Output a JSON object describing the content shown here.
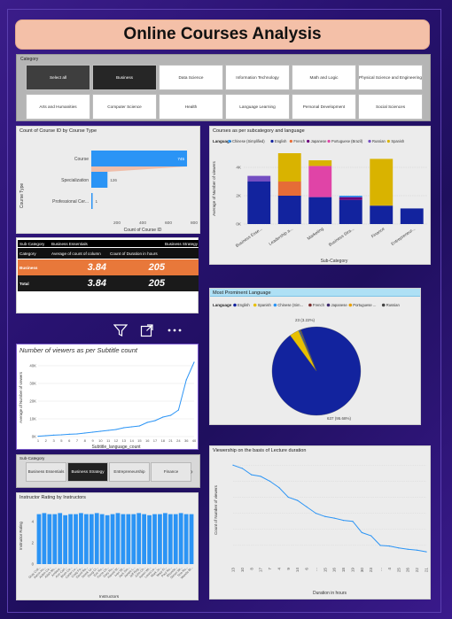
{
  "title": "Online Courses Analysis",
  "category_slicer": {
    "header": "Category",
    "row1": [
      "Select all",
      "Business",
      "Data Science",
      "Information Technology",
      "Math and Logic",
      "Physical Science and Engineering"
    ],
    "row2": [
      "Arts and Humanities",
      "Computer Science",
      "Health",
      "Language Learning",
      "Personal Development",
      "Social Sciences"
    ],
    "selected": "Business"
  },
  "funnel": {
    "title": "Count of Course ID by Course Type",
    "y_axis_label": "Course Type",
    "x_axis_label": "Count of Course ID",
    "x_ticks": [
      "200",
      "400",
      "600",
      "800"
    ],
    "accent": "#2b94f5"
  },
  "subcat_lang": {
    "title": "Courses as per subcategory and language",
    "legend_label": "Language",
    "y_axis_label": "Average of Number of viewers",
    "x_axis_label": "Sub-Category",
    "y_ticks": [
      "0K",
      "2K",
      "4K"
    ]
  },
  "table": {
    "header_group_col": "Sub-Category",
    "header_group_1": "Business Essentials",
    "header_group_2": "Business Strategy",
    "columns": [
      "Category",
      "Average of count of column",
      "Count of Duration in hours"
    ],
    "rows": [
      {
        "category": "Business",
        "avg": "3.84",
        "count": "205"
      },
      {
        "category": "Total",
        "avg": "3.84",
        "count": "205"
      }
    ]
  },
  "visual_header_icons": [
    "filter-icon",
    "focus-mode-icon",
    "more-options-icon"
  ],
  "subtitle_chart": {
    "title": "Number of viewers as per Subtitle count",
    "y_axis_label": "Average of Number of viewers",
    "x_axis_label": "Subtitle_language_count",
    "y_ticks": [
      "0K",
      "10K",
      "20K",
      "30K",
      "40K"
    ],
    "x_ticks": [
      "1",
      "2",
      "3",
      "5",
      "6",
      "7",
      "8",
      "9",
      "10",
      "11",
      "12",
      "13",
      "14",
      "15",
      "16",
      "17",
      "18",
      "21",
      "24",
      "36",
      "40"
    ]
  },
  "prominent_lang": {
    "title": "Most Prominent Language",
    "legend_label": "Language",
    "legend": [
      {
        "name": "English",
        "color": "#12239e"
      },
      {
        "name": "Spanish",
        "color": "#e8c000"
      },
      {
        "name": "Chinese (Sim...",
        "color": "#2b94f5"
      },
      {
        "name": "French",
        "color": "#7a2f2f"
      },
      {
        "name": "Japanese",
        "color": "#3d2a6e"
      },
      {
        "name": "Portuguese ...",
        "color": "#e8a000"
      },
      {
        "name": "Russian",
        "color": "#444"
      }
    ],
    "label_top": "23 (3.22%)",
    "label_bottom": "637 (95.68%)"
  },
  "subcat_slicer": {
    "header": "Sub-Category",
    "items": [
      "Business Essentials",
      "Business Strategy",
      "Entrepreneurship",
      "Finance"
    ],
    "selected": "Business Strategy",
    "next_arrow": "›"
  },
  "rating_chart": {
    "title": "Instructor Rating by Instructors",
    "y_axis_label": "Instructor Rating",
    "x_axis_label": "Instructors",
    "y_ticks": [
      "0",
      "2",
      "4"
    ],
    "x_ticks": [
      "Gray Coll...",
      "Aaron Ho...",
      "Aidan Ca...",
      "Ailish Mc...",
      "Andrew...",
      "Ann Carl...",
      "Brian Ca...",
      "Carter Lu...",
      "Craig Fa...",
      "David Ra...",
      "Derek Ly...",
      "Doug Cr...",
      "Eric Ro...",
      "Fiona Ch...",
      "Gary Ro...",
      "Harold W...",
      "Ivan Wi...",
      "Jack Sm...",
      "James L...",
      "Jeff Rog...",
      "John Ch...",
      "Karen Wi...",
      "Laura Le...",
      "Mark Jo...",
      "Mary Fl...",
      "Paul Ro...",
      "Rhonda...",
      "Simon Wi...",
      "Tina Ru...",
      "Wanda Br..."
    ]
  },
  "viewership_chart": {
    "title": "Viewership on the basis of Lecture duration",
    "y_axis_label": "Count of Number of viewers",
    "x_axis_label": "Duration in hours",
    "x_ticks": [
      "13",
      "10",
      "8",
      "17",
      "7",
      "4",
      "9",
      "14",
      "6",
      "...",
      "15",
      "16",
      "18",
      "19",
      "30",
      "23",
      "...",
      "4",
      "25",
      "26",
      "22",
      "21"
    ]
  },
  "chart_data": [
    {
      "type": "bar",
      "title": "Count of Course ID by Course Type",
      "categories": [
        "Course",
        "Specialization",
        "Professional Cer..."
      ],
      "values": [
        745,
        126,
        1
      ],
      "value_labels": [
        "745",
        "126",
        "1"
      ],
      "xlabel": "Count of Course ID",
      "ylabel": "Course Type",
      "xlim": [
        0,
        800
      ]
    },
    {
      "type": "bar",
      "stacked": true,
      "title": "Courses as per subcategory and language",
      "categories": [
        "Business Esse...",
        "Leadership a...",
        "Marketing",
        "Business Stra...",
        "Finance",
        "Entrepreneur..."
      ],
      "series": [
        {
          "name": "Chinese (Simplified)",
          "color": "#2b94f5",
          "values": [
            0,
            0,
            0,
            0.1,
            0,
            0
          ]
        },
        {
          "name": "English",
          "color": "#12239e",
          "values": [
            3.0,
            2.0,
            1.9,
            1.7,
            1.3,
            1.1
          ]
        },
        {
          "name": "French",
          "color": "#e66c37",
          "values": [
            0,
            1.0,
            0,
            0,
            0,
            0
          ]
        },
        {
          "name": "Japanese",
          "color": "#6b007b",
          "values": [
            0,
            0,
            0,
            0.2,
            0,
            0
          ]
        },
        {
          "name": "Portuguese (Brazil)",
          "color": "#e044a7",
          "values": [
            0,
            0,
            2.2,
            0,
            0,
            0
          ]
        },
        {
          "name": "Russian",
          "color": "#744ec2",
          "values": [
            0.4,
            0,
            0,
            0,
            0,
            0
          ]
        },
        {
          "name": "Spanish",
          "color": "#d9b300",
          "values": [
            0,
            2.0,
            0.4,
            0,
            3.3,
            0
          ]
        }
      ],
      "xlabel": "Sub-Category",
      "ylabel": "Average of Number of viewers",
      "ylim": [
        0,
        5
      ],
      "y_tick_values": [
        0,
        2,
        4
      ]
    },
    {
      "type": "line",
      "title": "Number of viewers as per Subtitle count",
      "x": [
        "1",
        "2",
        "3",
        "5",
        "6",
        "7",
        "8",
        "9",
        "10",
        "11",
        "12",
        "13",
        "14",
        "15",
        "16",
        "17",
        "18",
        "21",
        "24",
        "36",
        "40"
      ],
      "values": [
        0.2,
        0.5,
        0.8,
        1.0,
        1.3,
        1.5,
        2.0,
        2.5,
        3.0,
        3.5,
        4.0,
        5.0,
        5.5,
        6.0,
        8.0,
        9.0,
        11.0,
        12.0,
        15.0,
        32.0,
        42.0
      ],
      "xlabel": "Subtitle_language_count",
      "ylabel": "Average of Number of viewers",
      "ylim": [
        0,
        45
      ],
      "y_tick_values": [
        0,
        10,
        20,
        30,
        40
      ]
    },
    {
      "type": "pie",
      "title": "Most Prominent Language",
      "labels": [
        "English",
        "Spanish",
        "Chinese (Sim...",
        "French",
        "Japanese",
        "Portuguese ...",
        "Russian"
      ],
      "values": [
        637,
        23,
        2,
        1,
        1,
        1,
        1
      ]
    },
    {
      "type": "bar",
      "title": "Instructor Rating by Instructors",
      "values": [
        4.7,
        4.8,
        4.7,
        4.7,
        4.8,
        4.6,
        4.7,
        4.7,
        4.8,
        4.7,
        4.7,
        4.8,
        4.7,
        4.6,
        4.7,
        4.8,
        4.7,
        4.7,
        4.7,
        4.8,
        4.7,
        4.6,
        4.7,
        4.7,
        4.8,
        4.7,
        4.7,
        4.8,
        4.7,
        4.7
      ],
      "xlabel": "Instructors",
      "ylabel": "Instructor Rating",
      "ylim": [
        0,
        5.5
      ],
      "y_tick_values": [
        0,
        2,
        4
      ]
    },
    {
      "type": "line",
      "title": "Viewership on the basis of Lecture duration",
      "x": [
        "13",
        "10",
        "8",
        "17",
        "7",
        "4",
        "9",
        "14",
        "6",
        "...",
        "15",
        "16",
        "18",
        "19",
        "30",
        "23",
        "...",
        "4",
        "25",
        "26",
        "22",
        "21"
      ],
      "values": [
        30,
        29,
        27,
        26.5,
        25,
        23,
        20,
        19,
        17,
        15,
        14,
        13.5,
        12.8,
        12.5,
        9,
        8,
        5,
        4.8,
        4.2,
        3.8,
        3.5,
        3.0
      ],
      "xlabel": "Duration in hours",
      "ylabel": "Count of Number of viewers",
      "ylim": [
        0,
        32
      ]
    }
  ]
}
